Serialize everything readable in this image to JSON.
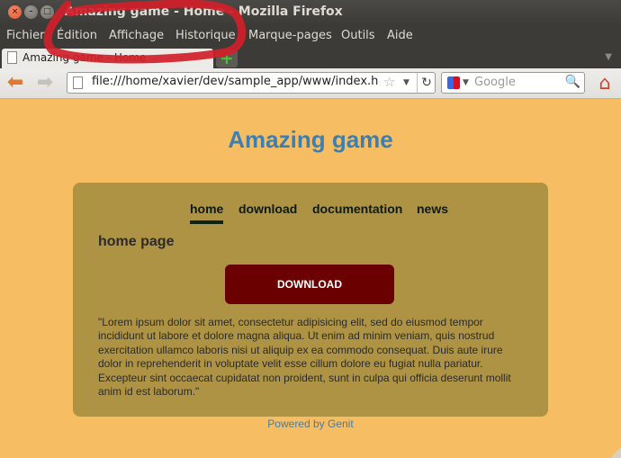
{
  "window": {
    "title": "Amazing game - Home - Mozilla Firefox"
  },
  "menu": {
    "items": [
      {
        "label": "Fichier"
      },
      {
        "label": "Édition"
      },
      {
        "label": "Affichage"
      },
      {
        "label": "Historique"
      },
      {
        "label": "Marque-pages"
      },
      {
        "label": "Outils"
      },
      {
        "label": "Aide"
      }
    ]
  },
  "tabs": [
    {
      "label": "Amazing game - Home",
      "active": true
    }
  ],
  "navbar": {
    "url": "file:///home/xavier/dev/sample_app/www/index.h",
    "search_placeholder": "Google"
  },
  "page": {
    "site_title": "Amazing game",
    "nav": [
      {
        "label": "home",
        "active": true
      },
      {
        "label": "download"
      },
      {
        "label": "documentation"
      },
      {
        "label": "news"
      }
    ],
    "section_title": "home page",
    "download_button": "DOWNLOAD",
    "body_text": "\"Lorem ipsum dolor sit amet, consectetur adipisicing elit, sed do eiusmod tempor incididunt ut labore et dolore magna aliqua. Ut enim ad minim veniam, quis nostrud exercitation ullamco laboris nisi ut aliquip ex ea commodo consequat. Duis aute irure dolor in reprehenderit in voluptate velit esse cillum dolore eu fugiat nulla pariatur. Excepteur sint occaecat cupidatat non proident, sunt in culpa qui officia deserunt mollit anim id est laborum.\"",
    "footer": "Powered by Genit"
  },
  "colors": {
    "page_background": "#f6bd62",
    "content_panel": "#ad9343",
    "title_blue": "#3d7fb0",
    "download_button": "#6a0000",
    "annotation_red": "#d0202a"
  },
  "icons": [
    "close-icon",
    "minimize-icon",
    "maximize-icon",
    "page-icon",
    "new-tab-icon",
    "back-arrow-icon",
    "forward-arrow-icon",
    "bookmark-star-icon",
    "reload-icon",
    "google-icon",
    "search-icon",
    "home-icon"
  ]
}
